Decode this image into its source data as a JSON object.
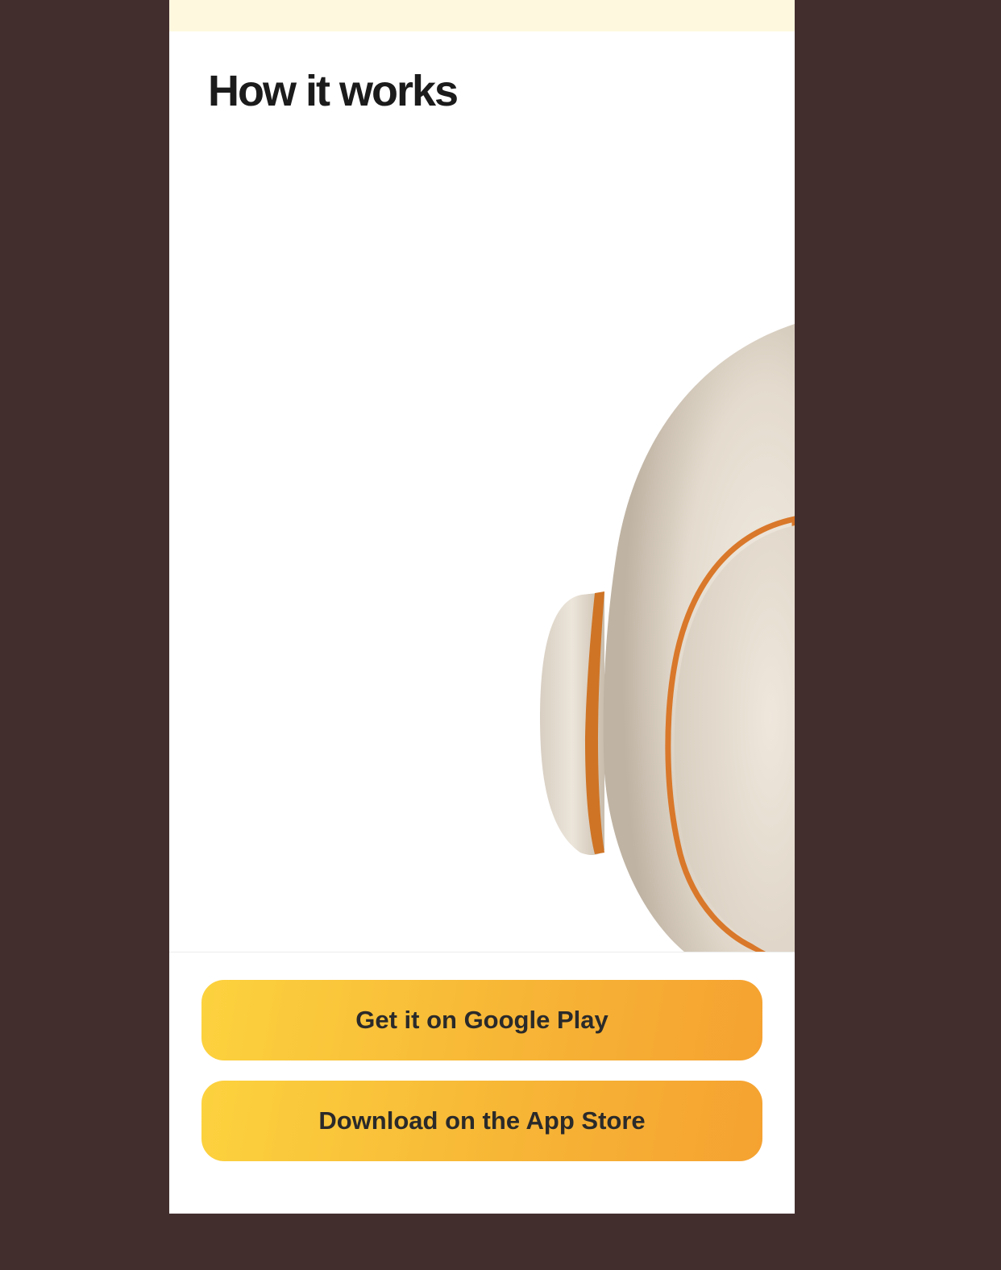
{
  "section": {
    "title": "How it works"
  },
  "buttons": {
    "google_play": "Get it on Google Play",
    "app_store": "Download on the App Store"
  },
  "colors": {
    "background": "#432e2e",
    "top_strip": "#fef8de",
    "button_gradient_start": "#fcd23e",
    "button_gradient_end": "#f5a231",
    "device_body": "#e6ddd0",
    "device_accent": "#d9782a"
  },
  "images": {
    "hero": "product-device-image"
  }
}
